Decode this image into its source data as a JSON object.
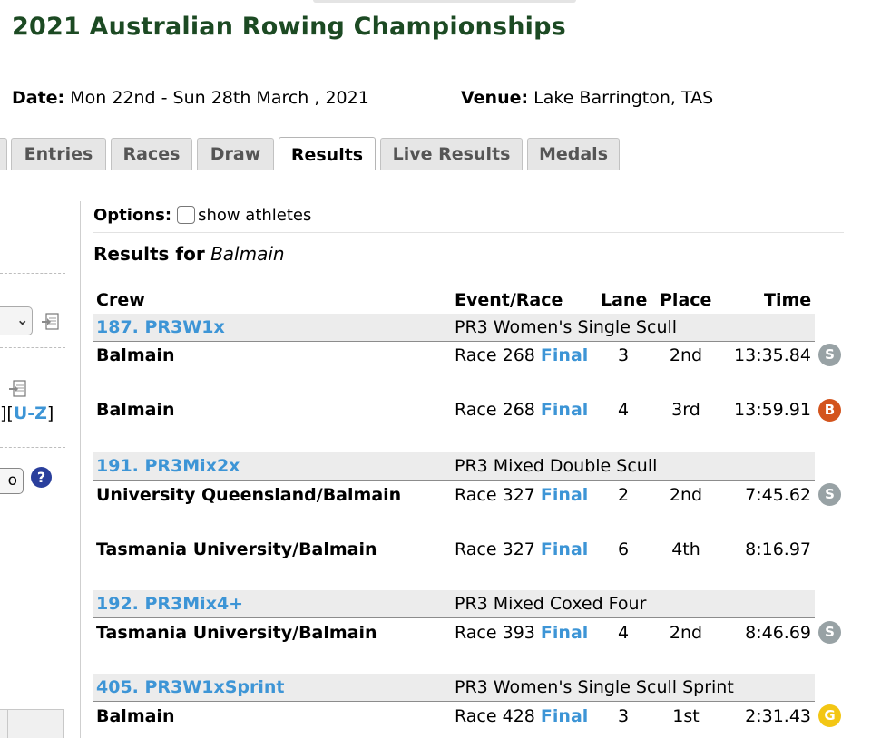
{
  "header": {
    "title": "2021 Australian Rowing Championships",
    "date_label": "Date:",
    "date_value": "Mon 22nd - Sun 28th March , 2021",
    "venue_label": "Venue:",
    "venue_value": "Lake Barrington, TAS"
  },
  "tabs": [
    {
      "label": "Entries",
      "active": false
    },
    {
      "label": "Races",
      "active": false
    },
    {
      "label": "Draw",
      "active": false
    },
    {
      "label": "Results",
      "active": true
    },
    {
      "label": "Live Results",
      "active": false
    },
    {
      "label": "Medals",
      "active": false
    }
  ],
  "left_panel": {
    "az_open": "][",
    "az_link": "U-Z",
    "az_close": "]",
    "go_label": "o",
    "help_glyph": "?"
  },
  "options": {
    "label": "Options:",
    "show_athletes": "show athletes"
  },
  "results_for": {
    "label": "Results for",
    "club": "Balmain"
  },
  "columns": {
    "crew": "Crew",
    "event": "Event/Race",
    "lane": "Lane",
    "place": "Place",
    "time": "Time"
  },
  "events": [
    {
      "code": "187. PR3W1x",
      "name": "PR3 Women's Single Scull",
      "rows": [
        {
          "crew": "Balmain",
          "race": "Race 268",
          "stage": "Final",
          "lane": "3",
          "place": "2nd",
          "time": "13:35.84",
          "medal": "S"
        },
        {
          "crew": "Balmain",
          "race": "Race 268",
          "stage": "Final",
          "lane": "4",
          "place": "3rd",
          "time": "13:59.91",
          "medal": "B"
        }
      ]
    },
    {
      "code": "191. PR3Mix2x",
      "name": "PR3 Mixed Double Scull",
      "rows": [
        {
          "crew": "University Queensland/Balmain",
          "race": "Race 327",
          "stage": "Final",
          "lane": "2",
          "place": "2nd",
          "time": "7:45.62",
          "medal": "S"
        },
        {
          "crew": "Tasmania University/Balmain",
          "race": "Race 327",
          "stage": "Final",
          "lane": "6",
          "place": "4th",
          "time": "8:16.97",
          "medal": ""
        }
      ]
    },
    {
      "code": "192. PR3Mix4+",
      "name": "PR3 Mixed Coxed Four",
      "rows": [
        {
          "crew": "Tasmania University/Balmain",
          "race": "Race 393",
          "stage": "Final",
          "lane": "4",
          "place": "2nd",
          "time": "8:46.69",
          "medal": "S"
        }
      ]
    },
    {
      "code": "405. PR3W1xSprint",
      "name": "PR3 Women's Single Scull Sprint",
      "rows": [
        {
          "crew": "Balmain",
          "race": "Race 428",
          "stage": "Final",
          "lane": "3",
          "place": "1st",
          "time": "2:31.43",
          "medal": "G"
        }
      ]
    }
  ],
  "medal_colors": {
    "G": "#f3c614",
    "S": "#98a2a5",
    "B": "#d3541d"
  }
}
